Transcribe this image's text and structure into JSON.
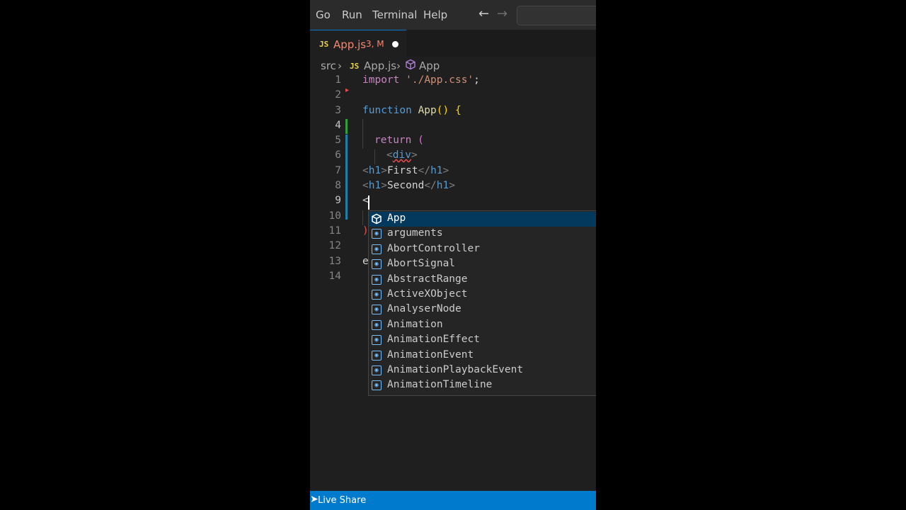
{
  "menubar": {
    "items": [
      "Go",
      "Run",
      "Terminal",
      "Help"
    ],
    "back_icon": "arrow-left-icon",
    "forward_icon": "arrow-right-icon"
  },
  "tab": {
    "badge": "JS",
    "name": "App.js",
    "status": "3, M"
  },
  "breadcrumb": {
    "folder": "src",
    "badge": "JS",
    "file": "App.js",
    "symbol": "App"
  },
  "code": {
    "lines": [
      "1",
      "2",
      "3",
      "4",
      "5",
      "6",
      "7",
      "8",
      "9",
      "10",
      "11",
      "12",
      "13",
      "14"
    ],
    "l1": {
      "kw": "import",
      "str": "'./App.css'",
      "semi": ";"
    },
    "l3": {
      "kw": "function",
      "fn": "App",
      "parens": "()",
      "brace": "{"
    },
    "l5": {
      "kw": "return",
      "paren": "("
    },
    "l6": {
      "open": "<",
      "tag": "div",
      "close": ">"
    },
    "l7": {
      "open": "<",
      "tag": "h1",
      "close": ">",
      "text": "First",
      "end_open": "</",
      "end_tag": "h1",
      "end_close": ">"
    },
    "l8": {
      "open": "<",
      "tag": "h1",
      "close": ">",
      "text": "Second",
      "end_open": "</",
      "end_tag": "h1",
      "end_close": ">"
    },
    "l9": {
      "text": "<"
    },
    "l11": {
      "text": ")"
    },
    "l13": {
      "text": "e"
    }
  },
  "suggestions": [
    {
      "label": "App",
      "icon": "symbol-class-icon",
      "selected": true
    },
    {
      "label": "arguments",
      "icon": "symbol-variable-icon",
      "selected": false
    },
    {
      "label": "AbortController",
      "icon": "symbol-variable-icon",
      "selected": false
    },
    {
      "label": "AbortSignal",
      "icon": "symbol-variable-icon",
      "selected": false
    },
    {
      "label": "AbstractRange",
      "icon": "symbol-variable-icon",
      "selected": false
    },
    {
      "label": "ActiveXObject",
      "icon": "symbol-variable-icon",
      "selected": false
    },
    {
      "label": "AnalyserNode",
      "icon": "symbol-variable-icon",
      "selected": false
    },
    {
      "label": "Animation",
      "icon": "symbol-variable-icon",
      "selected": false
    },
    {
      "label": "AnimationEffect",
      "icon": "symbol-variable-icon",
      "selected": false
    },
    {
      "label": "AnimationEvent",
      "icon": "symbol-variable-icon",
      "selected": false
    },
    {
      "label": "AnimationPlaybackEvent",
      "icon": "symbol-variable-icon",
      "selected": false
    },
    {
      "label": "AnimationTimeline",
      "icon": "symbol-variable-icon",
      "selected": false
    }
  ],
  "statusbar": {
    "live_share": "Live Share"
  },
  "colors": {
    "accent": "#007acc",
    "selection": "#04395e",
    "modified": "#f48771"
  }
}
